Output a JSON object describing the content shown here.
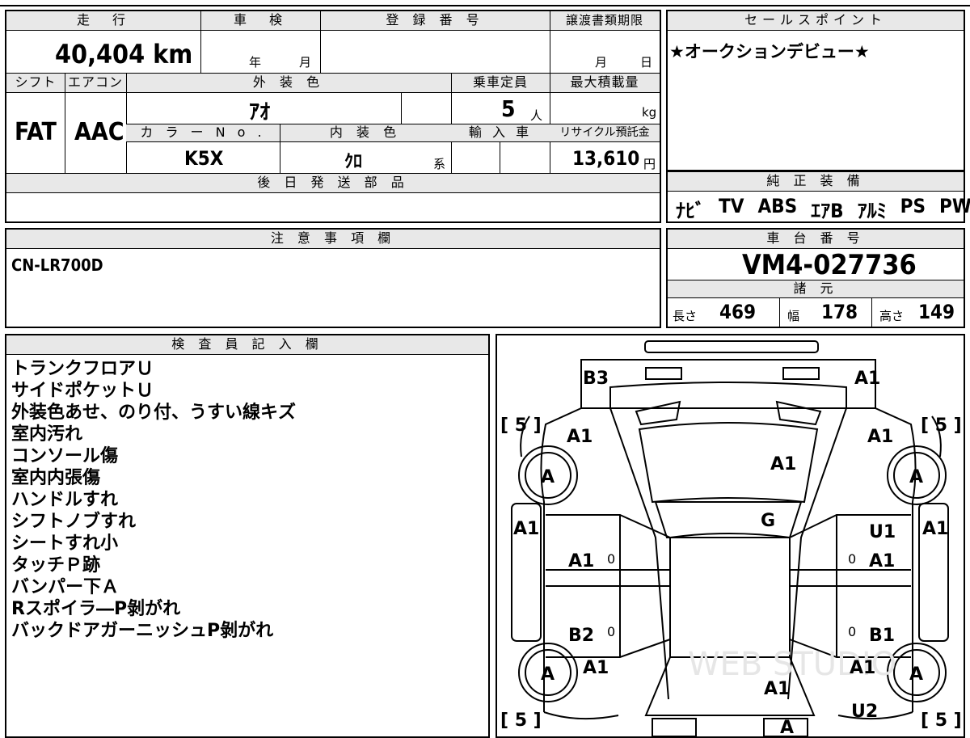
{
  "left_top": {
    "headers": {
      "mileage": "走　行",
      "inspection": "車　検",
      "registration_no": "登 録 番 号",
      "transfer_deadline": "譲渡書類期限",
      "shift": "シフト",
      "aircon": "エアコン",
      "exterior_color": "外 装 色",
      "capacity": "乗車定員",
      "max_load": "最大積載量",
      "color_no": "カ ラ ー N o .",
      "interior_color": "内 装 色",
      "import": "輸 入 車",
      "recycle": "リサイクル預託金",
      "later_parts": "後 日 発 送 部 品"
    },
    "values": {
      "mileage": "40,404 km",
      "inspection_year_unit": "年",
      "inspection_month_unit": "月",
      "transfer_month_unit": "月",
      "transfer_day_unit": "日",
      "shift": "FAT",
      "aircon": "AAC",
      "exterior_color": "ｱｵ",
      "capacity": "5",
      "capacity_unit": "人",
      "max_load_unit": "kg",
      "color_no": "K5X",
      "interior_color": "ｸﾛ",
      "interior_suffix": "系",
      "recycle": "13,610",
      "recycle_unit": "円"
    }
  },
  "sales_point": {
    "header": "セールスポイント",
    "text": "★オークションデビュー★"
  },
  "genuine_equipment": {
    "header": "純 正 装 備",
    "items": [
      "ﾅﾋﾞ",
      "TV",
      "ABS",
      "ｴｱB",
      "ｱﾙﾐ",
      "PS",
      "PW"
    ]
  },
  "notes": {
    "header": "注 意 事 項 欄",
    "text": "CN-LR700D"
  },
  "chassis": {
    "header": "車 台 番 号",
    "number": "VM4-027736"
  },
  "dimensions": {
    "header": "諸 元",
    "length_label": "長さ",
    "length": "469",
    "width_label": "幅",
    "width": "178",
    "height_label": "高さ",
    "height": "149"
  },
  "inspector": {
    "header": "検 査 員 記 入 欄",
    "lines": [
      "トランクフロアＵ",
      "サイドポケットＵ",
      "外装色あせ、のり付、うすい線キズ",
      "室内汚れ",
      "コンソール傷",
      "室内内張傷",
      "ハンドルすれ",
      "シフトノブすれ",
      "シートすれ小",
      "タッチＰ跡",
      "バンパー下Ａ",
      "Rスポイラ―P剝がれ",
      "バックドアガーニッシュP剝がれ"
    ]
  },
  "diagram": {
    "watermark": "WEB STUDIO",
    "tire_marks": [
      "[ 5 ]",
      "[ 5 ]",
      "[ 5 ]",
      "[ 5 ]"
    ],
    "marks": {
      "rear_left": "B3",
      "rear_right": "A1",
      "rear_quarter_left": "A1",
      "rear_quarter_right": "A1",
      "roof": "A1",
      "wheel_rl": "A",
      "wheel_rr": "A",
      "wheel_fl": "A",
      "wheel_fr": "A",
      "glass": "G",
      "side_left": "A1",
      "side_right": "A1",
      "door_rl": "A1",
      "door_rr_top": "U1",
      "door_rr": "A1",
      "door_fl": "B2",
      "door_fr": "B1",
      "fender_fl": "A1",
      "fender_fr": "A1",
      "hood": "A1",
      "front_fr": "U2",
      "front_center": "A",
      "zero": "0"
    }
  }
}
